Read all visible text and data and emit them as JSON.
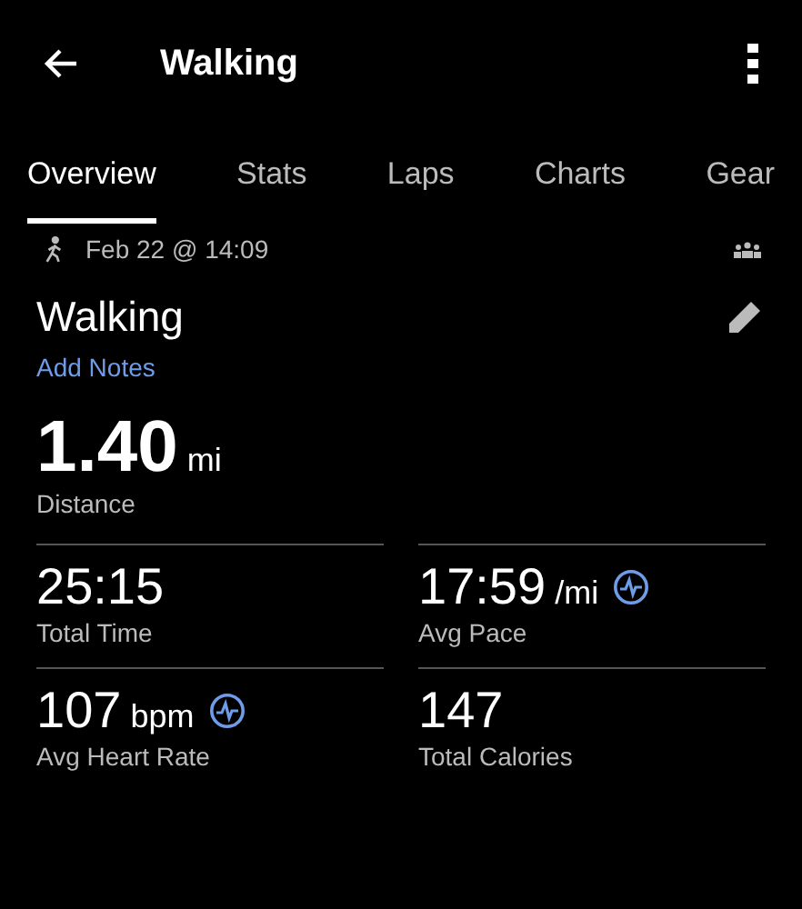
{
  "app_bar": {
    "title": "Walking"
  },
  "tabs": [
    {
      "label": "Overview",
      "selected": true
    },
    {
      "label": "Stats",
      "selected": false
    },
    {
      "label": "Laps",
      "selected": false
    },
    {
      "label": "Charts",
      "selected": false
    },
    {
      "label": "Gear",
      "selected": false
    }
  ],
  "activity": {
    "datetime": "Feb 22 @ 14:09",
    "name": "Walking",
    "add_notes": "Add Notes"
  },
  "distance": {
    "value": "1.40",
    "unit": "mi",
    "label": "Distance"
  },
  "stats": [
    {
      "value": "25:15",
      "label": "Total Time",
      "chart": false
    },
    {
      "value": "17:59",
      "unit": "/mi",
      "label": "Avg Pace",
      "chart": true
    },
    {
      "value": "107",
      "unit": "bpm",
      "label": "Avg Heart Rate",
      "chart": true
    },
    {
      "value": "147",
      "label": "Total Calories",
      "chart": false
    }
  ]
}
